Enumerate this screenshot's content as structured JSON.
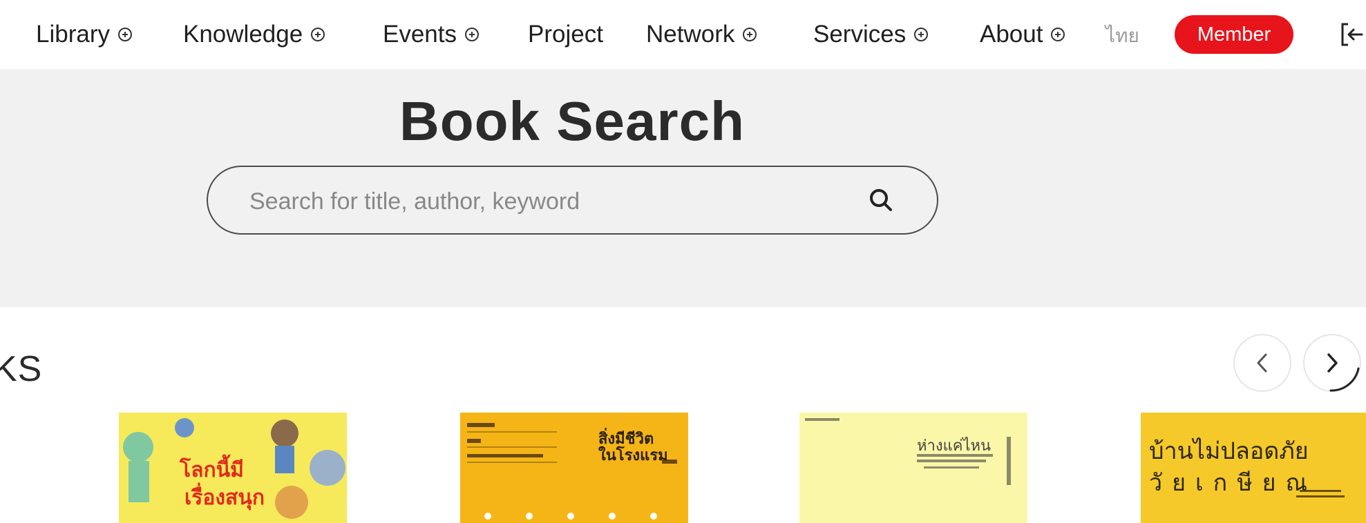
{
  "nav": {
    "items": [
      {
        "label": "Library",
        "has_plus": true
      },
      {
        "label": "Knowledge",
        "has_plus": true
      },
      {
        "label": "Events",
        "has_plus": true
      },
      {
        "label": "Project",
        "has_plus": false
      },
      {
        "label": "Network",
        "has_plus": true
      },
      {
        "label": "Services",
        "has_plus": true
      },
      {
        "label": "About",
        "has_plus": true
      }
    ],
    "language": "ไทย",
    "member_label": "Member",
    "login_icon": "login-icon"
  },
  "hero": {
    "title": "Book Search",
    "search_placeholder": "Search for title, author, keyword",
    "search_value": ""
  },
  "section": {
    "title_visible": "KS"
  },
  "books": [
    {
      "cover_text": [
        "โลกนี้มี",
        "เรื่องสนุก"
      ],
      "cover_color": "#f6ea5b"
    },
    {
      "cover_text": [
        "สิ่งมีชีวิต",
        "ในโรงแรม"
      ],
      "cover_color": "#f6b516"
    },
    {
      "cover_text": [
        "ห่างแค่ไหน"
      ],
      "cover_color": "#fbf7a9"
    },
    {
      "cover_text": [
        "บ้านไม่ปลอดภัย",
        "วัยเกษียณ"
      ],
      "cover_color": "#f5c92a"
    }
  ],
  "colors": {
    "accent": "#e8141b",
    "hero_bg": "#f2f1f1"
  }
}
